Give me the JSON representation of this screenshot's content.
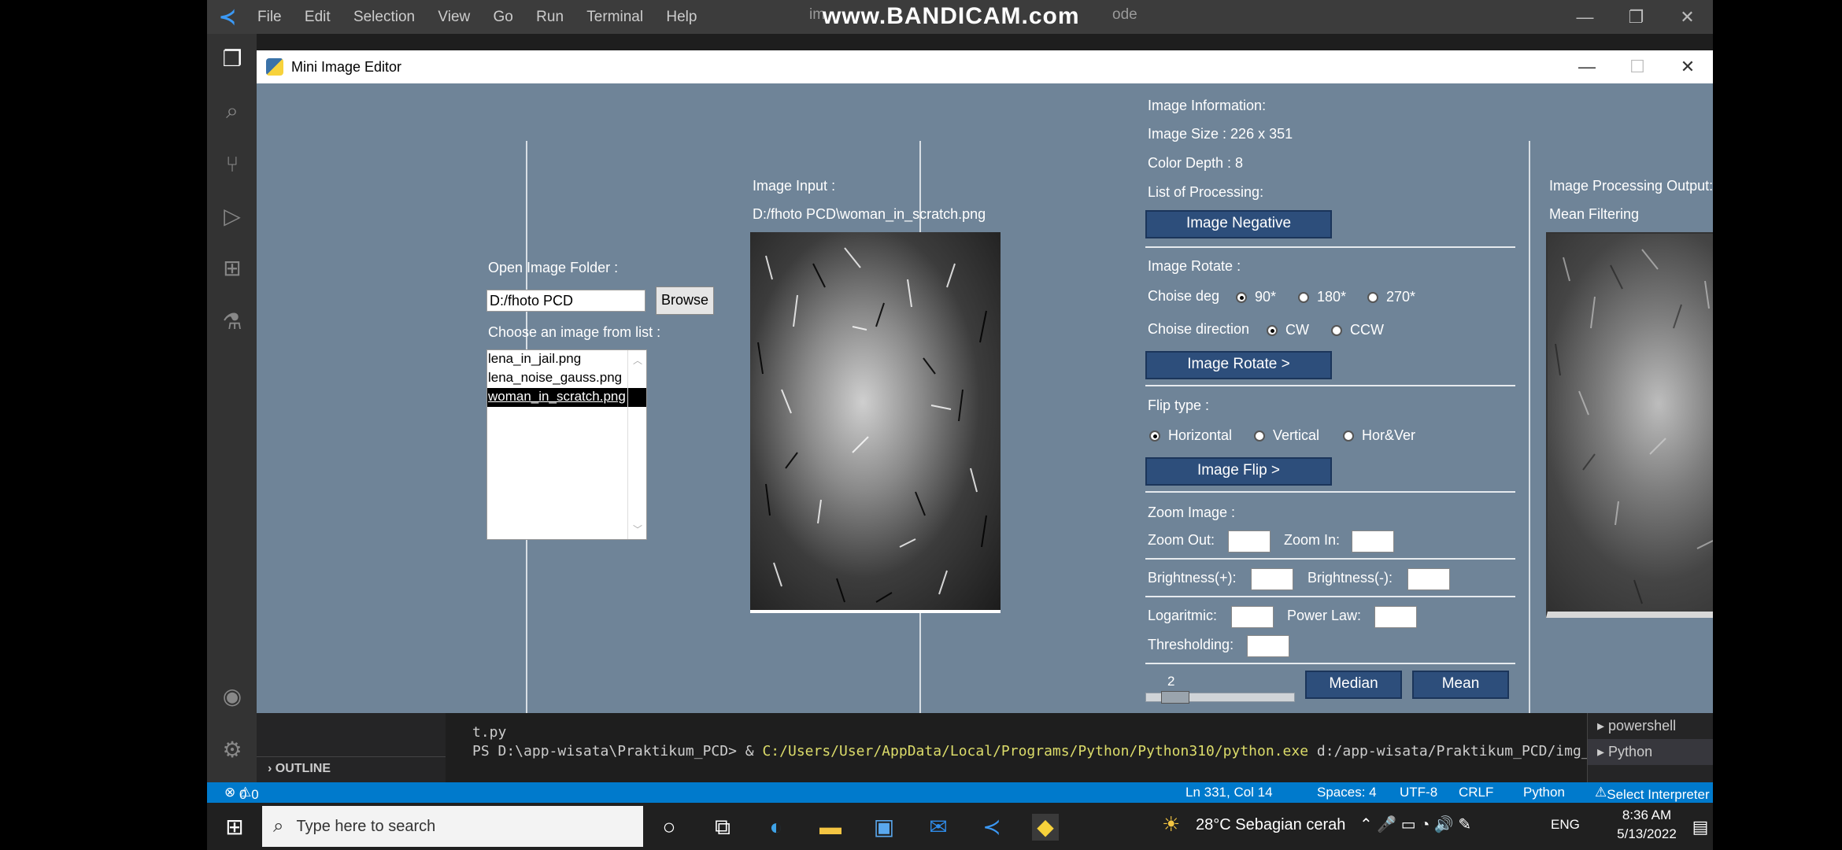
{
  "vscode": {
    "menu": [
      "File",
      "Edit",
      "Selection",
      "View",
      "Go",
      "Run",
      "Terminal",
      "Help"
    ],
    "title_fragment_left": "im",
    "title_fragment_right": "ode",
    "watermark": "www.BANDICAM.com"
  },
  "editor_window": {
    "title": "Mini Image Editor",
    "open_folder_label": "Open Image Folder :",
    "folder_value": "D:/fhoto PCD",
    "browse_label": "Browse",
    "choose_label": "Choose an image from list :",
    "files": [
      "lena_in_jail.png",
      "lena_noise_gauss.png",
      "woman_in_scratch.png"
    ],
    "selected_file": "woman_in_scratch.png",
    "input_label": "Image Input :",
    "input_path": "D:/fhoto PCD\\woman_in_scratch.png",
    "info_label": "Image Information:",
    "image_size": "Image Size : 226 x 351",
    "color_depth": "Color Depth : 8",
    "processing_label": "List of Processing:",
    "negative_btn": "Image Negative",
    "rotate_label": "Image Rotate :",
    "deg_label": "Choise deg",
    "deg_options": [
      "90*",
      "180*",
      "270*"
    ],
    "dir_label": "Choise direction",
    "dir_options": [
      "CW",
      "CCW"
    ],
    "rotate_btn": "Image Rotate >",
    "flip_label": "Flip type :",
    "flip_options": [
      "Horizontal",
      "Vertical",
      "Hor&Ver"
    ],
    "flip_btn": "Image Flip >",
    "zoom_label": "Zoom Image :",
    "zoom_out": "Zoom Out:",
    "zoom_in": "Zoom In:",
    "bright_plus": "Brightness(+):",
    "bright_minus": "Brightness(-):",
    "log_label": "Logaritmic:",
    "power_label": "Power Law:",
    "thresh_label": "Thresholding:",
    "slider_value": "2",
    "median_btn": "Median",
    "mean_btn": "Mean",
    "output_label": "Image Processing Output:",
    "output_method": "Mean Filtering"
  },
  "terminal": {
    "line1": "t.py",
    "prompt": "PS D:\\app-wisata\\Praktikum_PCD> & ",
    "exe": "C:/Users/User/AppData/Local/Programs/Python/Python310/python.exe",
    "arg": " d:/app-wisata/Praktikum_PCD/img_viewer.py",
    "sessions": [
      "powershell",
      "Python"
    ]
  },
  "sidebar": {
    "outline": "OUTLINE"
  },
  "status": {
    "errors": "0",
    "warnings": "0",
    "position": "Ln 331, Col 14",
    "spaces": "Spaces: 4",
    "encoding": "UTF-8",
    "eol": "CRLF",
    "language": "Python",
    "interpreter": "Select Interpreter"
  },
  "taskbar": {
    "search_placeholder": "Type here to search",
    "weather": "28°C  Sebagian cerah",
    "lang": "ENG",
    "time": "8:36 AM",
    "date": "5/13/2022"
  },
  "colors": {
    "accent": "#007acc",
    "window_bg": "#6f8498",
    "button": "#2d4e7b"
  }
}
